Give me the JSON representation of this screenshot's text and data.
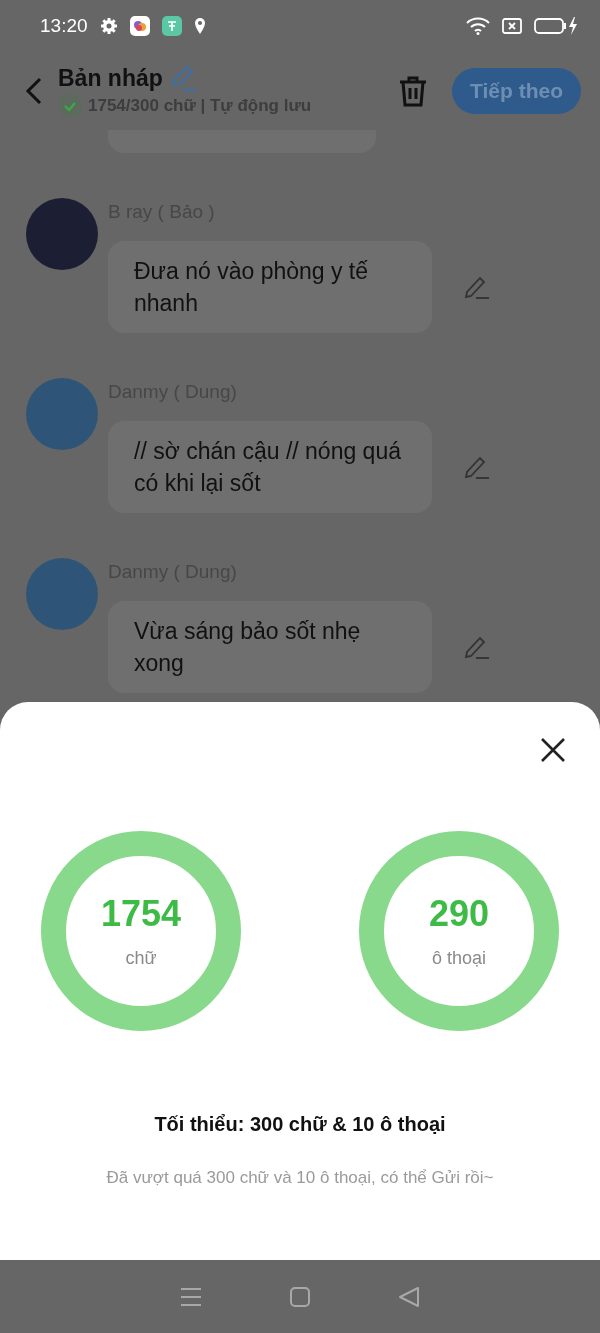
{
  "status_bar": {
    "time": "13:20"
  },
  "header": {
    "title": "Bản nháp",
    "saved": true,
    "subtitle": "1754/300 chữ | Tự động lưu",
    "next_button": "Tiếp theo"
  },
  "messages": [
    {
      "sender": "B ray ( Bảo )",
      "text": "Đưa nó vào phòng y tế nhanh"
    },
    {
      "sender": "Danmy ( Dung)",
      "text": "// sờ chán cậu // nóng quá có khi lại sốt"
    },
    {
      "sender": "Danmy ( Dung)",
      "text": "Vừa sáng bảo sốt nhẹ xong"
    }
  ],
  "sheet": {
    "stats": [
      {
        "value": "1754",
        "label": "chữ"
      },
      {
        "value": "290",
        "label": "ô thoại"
      }
    ],
    "requirement": "Tối thiểu: 300 chữ & 10 ô thoại",
    "note": "Đã vượt quá 300 chữ và 10 ô thoại, có thể Gửi rồi~"
  }
}
